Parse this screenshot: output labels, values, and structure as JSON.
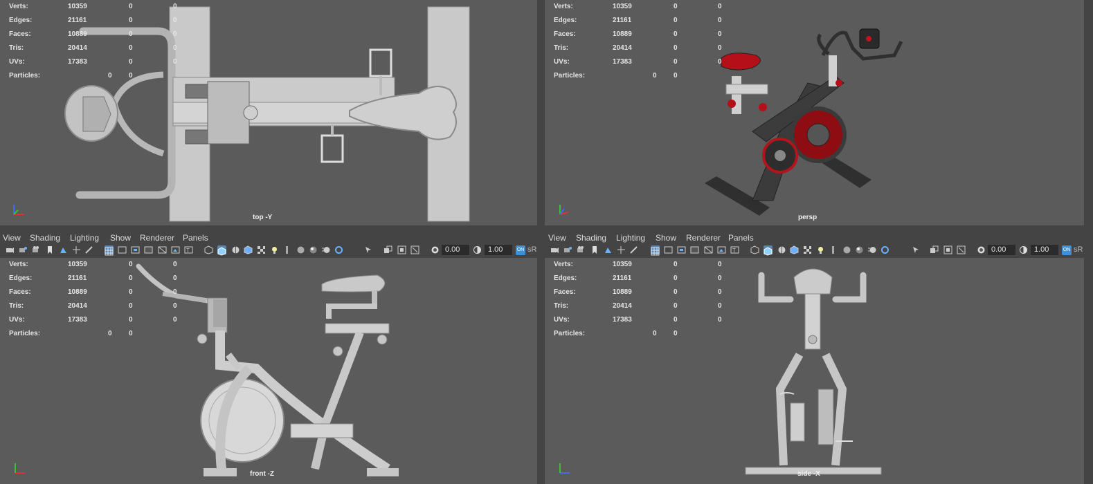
{
  "hud": {
    "rows": [
      {
        "label": "Verts:",
        "v1": "10359",
        "v2": "0",
        "v3": "0"
      },
      {
        "label": "Edges:",
        "v1": "21161",
        "v2": "0",
        "v3": "0"
      },
      {
        "label": "Faces:",
        "v1": "10889",
        "v2": "0",
        "v3": "0"
      },
      {
        "label": "Tris:",
        "v1": "20414",
        "v2": "0",
        "v3": "0"
      },
      {
        "label": "UVs:",
        "v1": "17383",
        "v2": "0",
        "v3": "0"
      },
      {
        "label": "Particles:",
        "v1": "0",
        "v2": "0"
      }
    ]
  },
  "viewports": {
    "top": {
      "camera": "top -Y"
    },
    "persp": {
      "camera": "persp"
    },
    "front": {
      "camera": "front -Z"
    },
    "side": {
      "camera": "side -X"
    }
  },
  "menus": [
    "View",
    "Shading",
    "Lighting",
    "Show",
    "Renderer",
    "Panels"
  ],
  "toolbar": {
    "field_a": "0.00",
    "field_b": "1.00",
    "on_label": "ON",
    "color_label": "sR"
  },
  "colors": {
    "viewport_bg": "#5b5b5b",
    "model_gray": "#c8c8c8",
    "accent_red": "#c0141e",
    "frame_dark": "#303030",
    "selection_blue": "#5a86b3"
  },
  "icons": {
    "axis": "axis-gizmo-icon",
    "camera": "camera-icon",
    "grid": "grid-icon",
    "wireframe": "wireframe-icon",
    "shaded": "shaded-cube-icon",
    "light": "light-icon",
    "isolate": "isolate-select-icon"
  }
}
